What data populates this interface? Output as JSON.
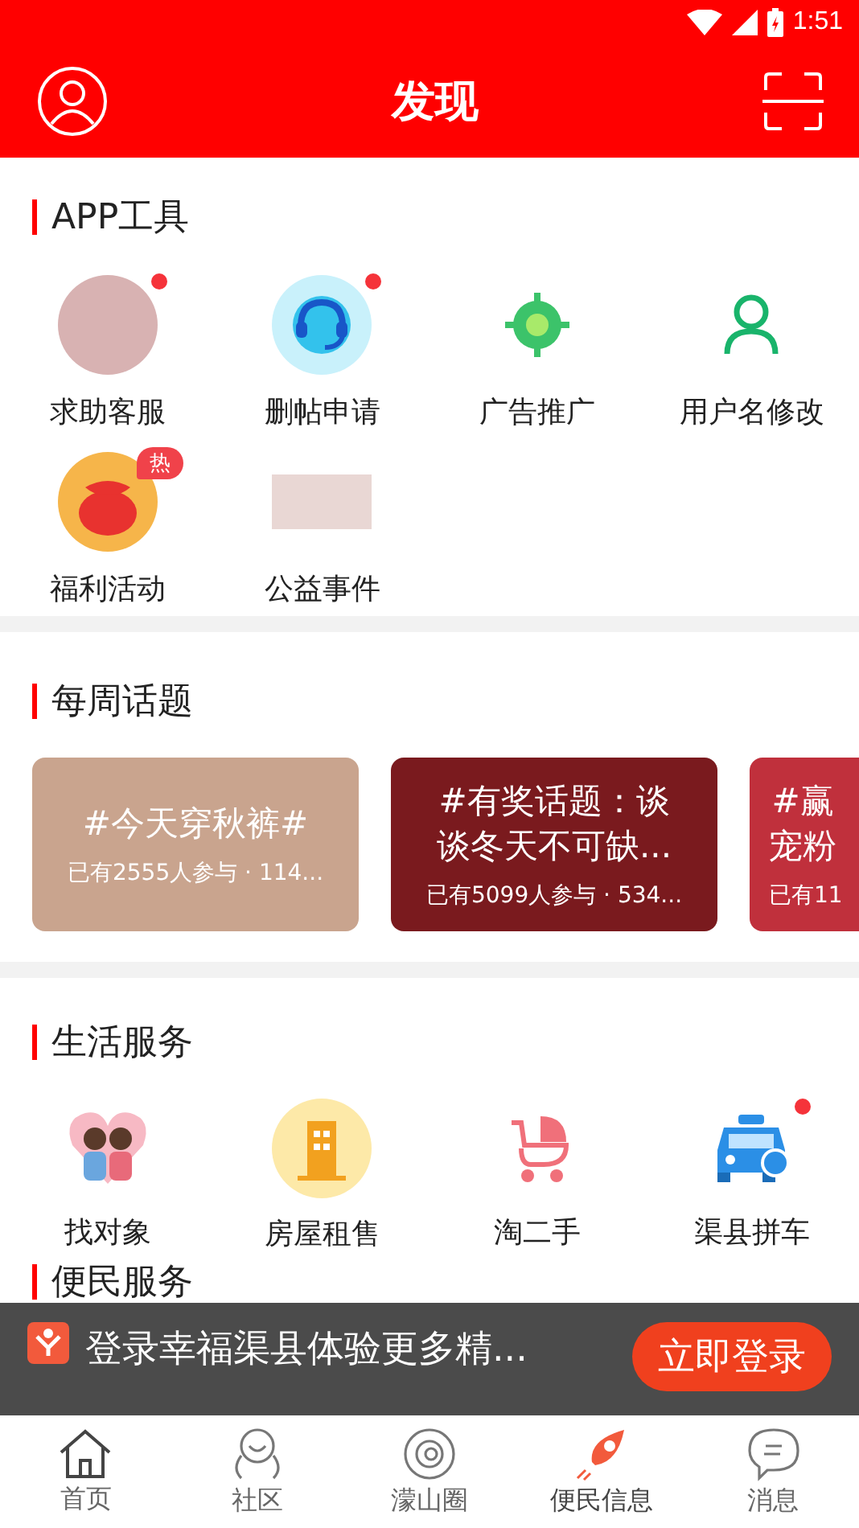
{
  "status_bar": {
    "time": "1:51"
  },
  "header": {
    "title": "发现"
  },
  "app_tools": {
    "title": "APP工具",
    "items": [
      {
        "label": "求助客服",
        "kind": "photo",
        "dot": true
      },
      {
        "label": "删帖申请",
        "kind": "headset",
        "dot": true
      },
      {
        "label": "广告推广",
        "kind": "target",
        "dot": false
      },
      {
        "label": "用户名修改",
        "kind": "user",
        "dot": false
      },
      {
        "label": "福利活动",
        "kind": "bag",
        "dot": false,
        "badge": "热"
      },
      {
        "label": "公益事件",
        "kind": "image",
        "dot": false
      }
    ]
  },
  "weekly_topics": {
    "title": "每周话题",
    "cards": [
      {
        "lines": [
          "#今天穿秋裤#"
        ],
        "meta": "已有2555人参与 · 114..."
      },
      {
        "lines": [
          "#有奖话题：谈",
          "谈冬天不可缺..."
        ],
        "meta": "已有5099人参与 · 534..."
      },
      {
        "lines": [
          "#赢",
          "宠粉"
        ],
        "meta": "已有11"
      }
    ]
  },
  "life_services": {
    "title": "生活服务",
    "items": [
      {
        "label": "找对象",
        "kind": "couple",
        "dot": false
      },
      {
        "label": "房屋租售",
        "kind": "building",
        "dot": false
      },
      {
        "label": "淘二手",
        "kind": "stroller",
        "dot": false
      },
      {
        "label": "渠县拼车",
        "kind": "car",
        "dot": true
      }
    ]
  },
  "convenience": {
    "title": "便民服务"
  },
  "login_banner": {
    "text": "登录幸福渠县体验更多精...",
    "button": "立即登录"
  },
  "bottom_nav": [
    {
      "label": "首页",
      "kind": "home",
      "selected": false
    },
    {
      "label": "社区",
      "kind": "community",
      "selected": false
    },
    {
      "label": "濛山圈",
      "kind": "orbit",
      "selected": false
    },
    {
      "label": "便民信息",
      "kind": "rocket",
      "selected": true
    },
    {
      "label": "消息",
      "kind": "chat",
      "selected": false
    }
  ]
}
